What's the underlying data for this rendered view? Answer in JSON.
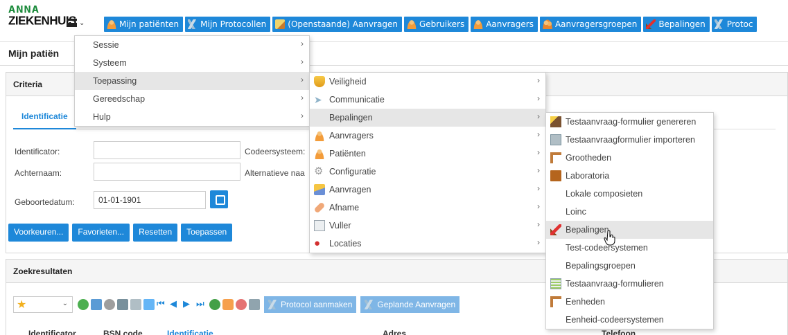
{
  "header": {
    "logo_line1": "ANNA",
    "logo_line2": "ZIEKENHUIS",
    "hamburger_icon": "hamburger-icon",
    "tabs": [
      {
        "label": "Mijn patiënten",
        "icon": "person-icon"
      },
      {
        "label": "Mijn Protocollen",
        "icon": "protocol-icon"
      },
      {
        "label": "(Openstaande) Aanvragen",
        "icon": "note-icon"
      },
      {
        "label": "Gebruikers",
        "icon": "person-icon"
      },
      {
        "label": "Aanvragers",
        "icon": "person-icon"
      },
      {
        "label": "Aanvragersgroepen",
        "icon": "group-icon"
      },
      {
        "label": "Bepalingen",
        "icon": "pin-icon"
      },
      {
        "label": "Protoc",
        "icon": "protocol-icon"
      }
    ]
  },
  "page": {
    "title": "Mijn patiën"
  },
  "criteria": {
    "header": "Criteria",
    "active_tab": "Identificatie",
    "fields": {
      "identificator_label": "Identificator:",
      "achternaam_label": "Achternaam:",
      "geboortedatum_label": "Geboortedatum:",
      "geboortedatum_value": "01-01-1901",
      "codeersysteem_label": "Codeersysteem:",
      "alternatieve_label": "Alternatieve naa"
    },
    "buttons": {
      "voorkeuren": "Voorkeuren...",
      "favorieten": "Favorieten...",
      "resetten": "Resetten",
      "toepassen": "Toepassen"
    }
  },
  "results": {
    "header": "Zoekresultaten",
    "protocol_button": "Protocol aanmaken",
    "geplande_button": "Geplande Aanvragen",
    "columns": [
      "Identificator",
      "BSN code",
      "Identificatie",
      "Adres",
      "Telefoon"
    ]
  },
  "menu_main": {
    "items": [
      {
        "label": "Sessie"
      },
      {
        "label": "Systeem"
      },
      {
        "label": "Toepassing"
      },
      {
        "label": "Gereedschap"
      },
      {
        "label": "Hulp"
      }
    ]
  },
  "menu_toepassing": {
    "items": [
      {
        "label": "Veiligheid",
        "icon": "shield-icon"
      },
      {
        "label": "Communicatie",
        "icon": "paper-plane-icon"
      },
      {
        "label": "Bepalingen",
        "icon": ""
      },
      {
        "label": "Aanvragers",
        "icon": "person-icon"
      },
      {
        "label": "Patiënten",
        "icon": "person-icon"
      },
      {
        "label": "Configuratie",
        "icon": "gear-icon"
      },
      {
        "label": "Aanvragen",
        "icon": "pen-icon"
      },
      {
        "label": "Afname",
        "icon": "bandage-icon"
      },
      {
        "label": "Vuller",
        "icon": "document-icon"
      },
      {
        "label": "Locaties",
        "icon": "location-pin-icon"
      }
    ]
  },
  "menu_bepalingen": {
    "items": [
      {
        "label": "Testaanvraag-formulier genereren",
        "icon": "wand-icon"
      },
      {
        "label": "Testaanvraagformulier importeren",
        "icon": "import-icon"
      },
      {
        "label": "Grootheden",
        "icon": "ruler-icon"
      },
      {
        "label": "Laboratoria",
        "icon": "building-icon"
      },
      {
        "label": "Lokale composieten",
        "icon": ""
      },
      {
        "label": "Loinc",
        "icon": ""
      },
      {
        "label": "Bepalingen",
        "icon": "pin-icon"
      },
      {
        "label": "Test-codeersystemen",
        "icon": ""
      },
      {
        "label": "Bepalingsgroepen",
        "icon": ""
      },
      {
        "label": "Testaanvraag-formulieren",
        "icon": "form-icon"
      },
      {
        "label": "Eenheden",
        "icon": "ruler-icon"
      },
      {
        "label": "Eenheid-codeersystemen",
        "icon": ""
      }
    ]
  },
  "colors": {
    "accent": "#1e88d9",
    "accent_light": "#7fb6e6",
    "menu_highlight": "#e6e6e6",
    "logo_green": "#1a8a3a"
  }
}
